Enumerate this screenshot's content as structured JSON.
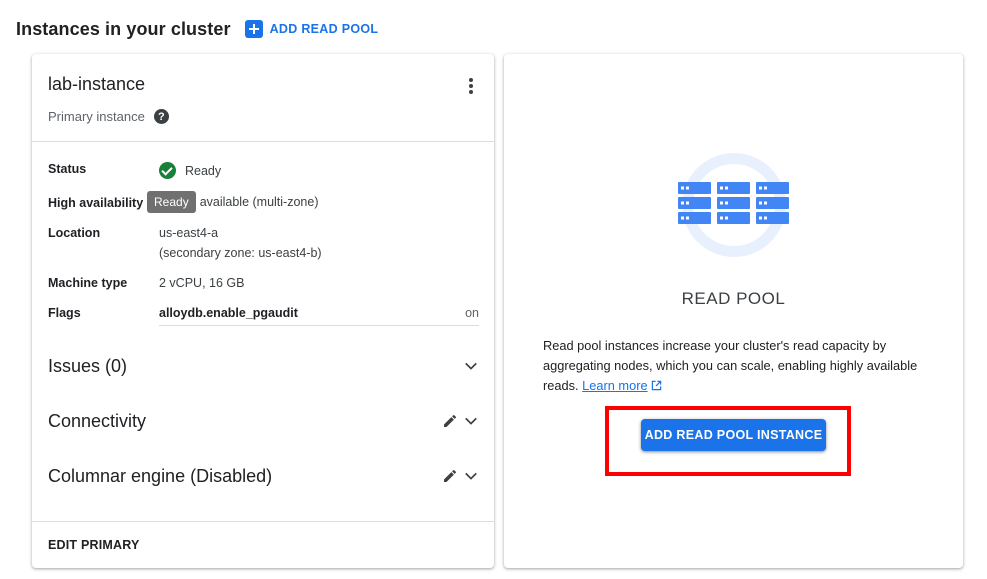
{
  "header": {
    "title": "Instances in your cluster",
    "add_read_pool_label": "ADD READ POOL"
  },
  "instance": {
    "name": "lab-instance",
    "role": "Primary instance",
    "help_glyph": "?",
    "details": {
      "status_label": "Status",
      "status_value": "Ready",
      "ha_label": "High availability",
      "ha_tooltip": "Ready",
      "ha_value": "available (multi-zone)",
      "location_label": "Location",
      "location_primary": "us-east4-a",
      "location_secondary": "(secondary zone: us-east4-b)",
      "machine_label": "Machine type",
      "machine_value": "2 vCPU, 16 GB",
      "flags_label": "Flags",
      "flag_name": "alloydb.enable_pgaudit",
      "flag_value": "on"
    },
    "sections": {
      "issues": "Issues (0)",
      "connectivity": "Connectivity",
      "columnar": "Columnar engine (Disabled)"
    },
    "edit_primary_label": "EDIT PRIMARY"
  },
  "read_pool": {
    "title": "READ POOL",
    "description": "Read pool instances increase your cluster's read capacity by aggregating nodes, which you can scale, enabling highly available reads.",
    "learn_more": "Learn more",
    "add_button": "ADD READ POOL INSTANCE"
  },
  "colors": {
    "primary_blue": "#1a73e8",
    "success_green": "#188038",
    "highlight_red": "#ff0000",
    "illus_light": "#e8f0fe",
    "illus_server": "#4285f4"
  },
  "icons": [
    "add-icon",
    "more-vert-icon",
    "help-icon",
    "check-circle-icon",
    "chevron-down-icon",
    "edit-icon",
    "external-link-icon",
    "server-rack-icon"
  ]
}
